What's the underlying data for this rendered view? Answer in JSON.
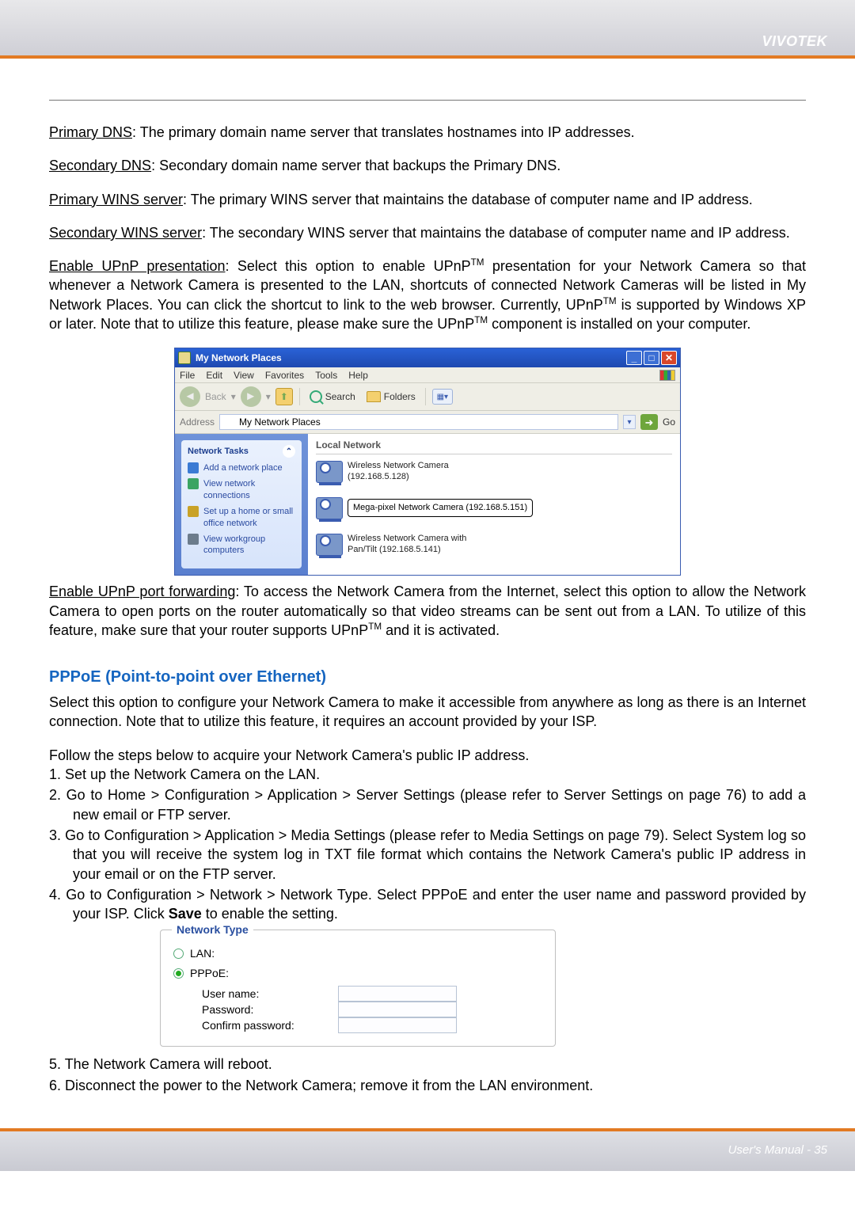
{
  "header": {
    "brand": "VIVOTEK"
  },
  "footer": {
    "text": "User's Manual - 35"
  },
  "dns": {
    "primary_term": "Primary DNS",
    "primary_text": ": The primary domain name server that translates hostnames into IP addresses.",
    "secondary_term": "Secondary DNS",
    "secondary_text": ": Secondary domain name server that backups the Primary DNS.",
    "pwins_term": "Primary WINS server",
    "pwins_text": ": The primary WINS server that maintains the database of computer name and IP address.",
    "swins_term": "Secondary WINS server",
    "swins_text": ": The secondary WINS server that maintains the database of computer name and IP address."
  },
  "upnp_pres": {
    "term": "Enable UPnP presentation",
    "text1": ": Select this option to enable UPnP",
    "tm": "TM",
    "text2": " presentation for your Network Camera so that whenever a Network Camera is presented to the LAN, shortcuts of connected Network Cameras will be listed in My Network Places. You can click the shortcut to link to the web browser. Currently, UPnP",
    "text3": " is supported by Windows XP or later. Note that to utilize this feature, please make sure the UPnP",
    "text4": " component is installed on your computer."
  },
  "np_window": {
    "title": "My Network Places",
    "menu": [
      "File",
      "Edit",
      "View",
      "Favorites",
      "Tools",
      "Help"
    ],
    "toolbar": {
      "back": "Back",
      "search": "Search",
      "folders": "Folders"
    },
    "address_label": "Address",
    "address_text": "My Network Places",
    "go_label": "Go",
    "side_header": "Network Tasks",
    "tasks": [
      "Add a network place",
      "View network connections",
      "Set up a home or small office network",
      "View workgroup computers"
    ],
    "group_label": "Local Network",
    "items": [
      {
        "name": "Wireless Network Camera (192.168.5.128)"
      },
      {
        "name": "Wireless Network Camera with Pan/Tilt (192.168.5.141)"
      }
    ],
    "callout": "Mega-pixel Network Camera (192.168.5.151)"
  },
  "upnp_fwd": {
    "term": "Enable UPnP port forwarding",
    "text1": ": To access the Network Camera from the Internet, select this option to allow the Network Camera to open ports on the router automatically so that video streams can be sent out from a LAN. To utilize of this feature, make sure that your router supports UPnP",
    "tm": "TM",
    "text2": " and it is activated."
  },
  "pppoe": {
    "title": "PPPoE (Point-to-point over Ethernet)",
    "intro": "Select this option to configure your Network Camera to make it accessible from anywhere as long as there is an Internet connection. Note that to utilize this feature, it requires an account provided by your ISP.",
    "lead": "Follow the steps below to acquire your Network Camera's public IP address.",
    "s1": "1. Set up the Network Camera on the LAN.",
    "s2": "2. Go to Home > Configuration > Application > Server Settings (please refer to Server Settings on page 76) to add a new email or FTP server.",
    "s3": "3. Go to Configuration > Application > Media Settings (please refer to Media Settings on page 79). Select System log so that you will receive the system log in TXT file format which contains the Network Camera's public IP address in your email or on the FTP server.",
    "s4a": "4. Go to Configuration > Network > Network Type. Select PPPoE and enter the user name and password provided by your ISP. Click ",
    "s4_bold": "Save",
    "s4b": " to enable the setting.",
    "s5": "5. The Network Camera will reboot.",
    "s6": "6. Disconnect the power to the Network Camera; remove it from the LAN environment."
  },
  "nt_panel": {
    "legend": "Network Type",
    "lan": "LAN:",
    "pppoe": "PPPoE:",
    "user": "User name:",
    "pass": "Password:",
    "confirm": "Confirm password:"
  }
}
